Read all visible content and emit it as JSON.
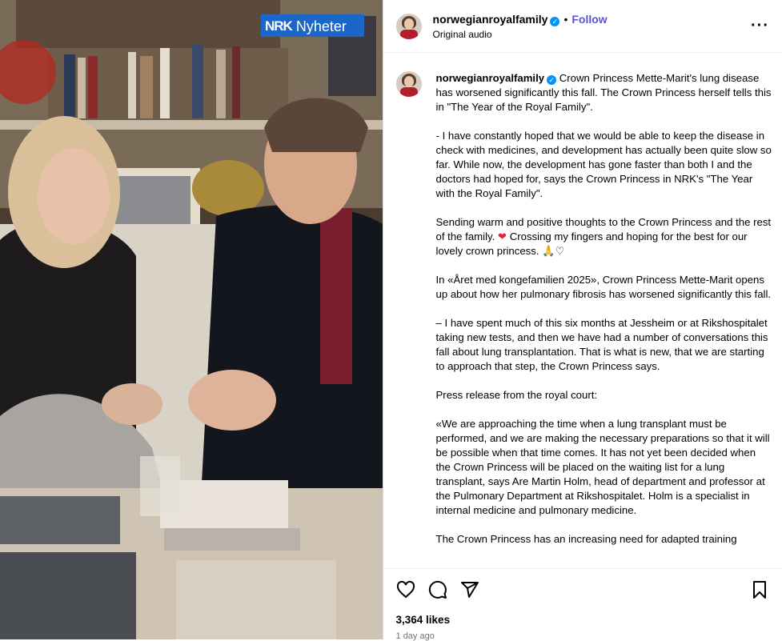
{
  "media": {
    "watermark": "Nyheter",
    "logo": "NRK"
  },
  "header": {
    "username": "norwegianroyalfamily",
    "follow_label": "Follow",
    "subtitle": "Original audio",
    "more_icon": "more-horizontal-icon"
  },
  "caption": {
    "username": "norwegianroyalfamily",
    "p1": "Crown Princess Mette-Marit's lung disease has worsened significantly this fall. The Crown Princess herself tells this in \"The Year of the Royal Family\".",
    "p2": "- I have constantly hoped that we would be able to keep the disease in check with medicines, and development has actually been quite slow so far. While now, the development has gone faster than both I and the doctors had hoped for, says the Crown Princess in NRK's \"The Year with the Royal Family\".",
    "p3a": "Sending warm and positive thoughts to the Crown Princess and the rest of the family.",
    "p3b": "Crossing my fingers and hoping for the best for our lovely crown princess.",
    "p4": "In «Året med kongefamilien 2025», Crown Princess Mette-Marit opens up about how her pulmonary fibrosis has worsened significantly this fall.",
    "p5": "– I have spent much of this six months at Jessheim or at Rikshospitalet taking new tests, and then we have had a number of conversations this fall about lung transplantation. That is what is new, that we are starting to approach that step, the Crown Princess says.",
    "p6": "Press release from the royal court:",
    "p7": "«We are approaching the time when a lung transplant must be performed, and we are making the necessary preparations so that it will be possible when that time comes. It has not yet been decided when the Crown Princess will be placed on the waiting list for a lung transplant, says Are Martin Holm, head of department and professor at the Pulmonary Department at Rikshospitalet. Holm is a specialist in internal medicine and pulmonary medicine.",
    "p8": "The Crown Princess has an increasing need for adapted training"
  },
  "actions": {
    "likes": "3,364 likes",
    "time": "1 day ago"
  }
}
